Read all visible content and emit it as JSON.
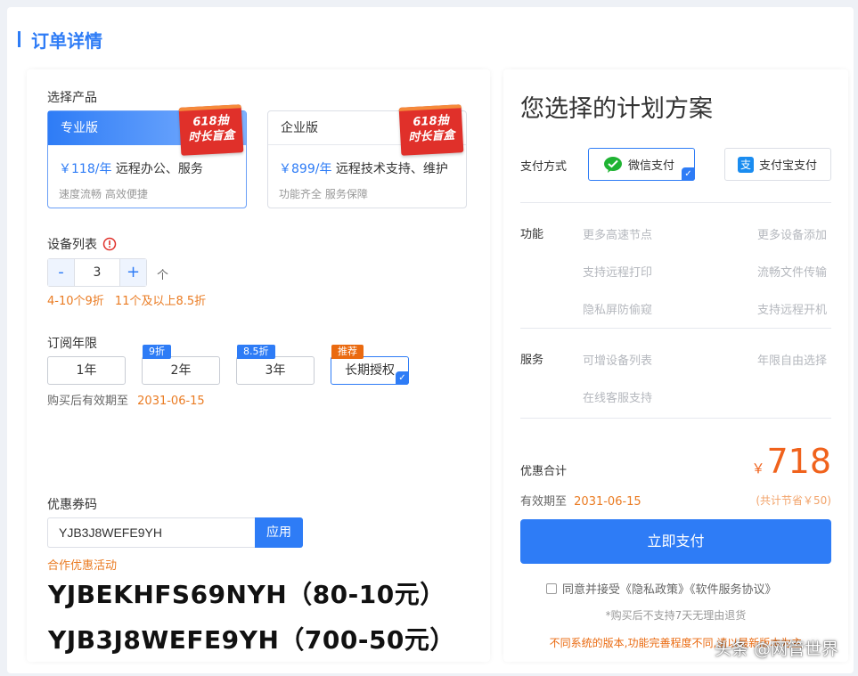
{
  "page_title": "订单详情",
  "product": {
    "label": "选择产品",
    "items": [
      {
        "name": "专业版",
        "price": "￥118/年",
        "price_desc": "远程办公、服务",
        "desc": "速度流畅 高效便捷",
        "badge_line1": "618抽",
        "badge_line2": "时长盲盒"
      },
      {
        "name": "企业版",
        "price": "￥899/年",
        "price_desc": "远程技术支持、维护",
        "desc": "功能齐全 服务保障",
        "badge_line1": "618抽",
        "badge_line2": "时长盲盒"
      }
    ]
  },
  "devices": {
    "label": "设备列表",
    "minus": "-",
    "value": "3",
    "plus": "+",
    "unit": "个",
    "discount1": "4-10个9折",
    "discount2": "11个及以上8.5折"
  },
  "subscription": {
    "label": "订阅年限",
    "options": [
      {
        "label": "1年",
        "tag": ""
      },
      {
        "label": "2年",
        "tag": "9折"
      },
      {
        "label": "3年",
        "tag": "8.5折"
      },
      {
        "label": "长期授权",
        "tag": "推荐"
      }
    ],
    "expiry_prefix": "购买后有效期至",
    "expiry_date": "2031-06-15"
  },
  "coupon": {
    "label": "优惠券码",
    "value": "YJB3J8WEFE9YH",
    "apply": "应用",
    "partner": "合作优惠活动",
    "code1": "YJBEKHFS69NYH（80-10元）",
    "code2": "YJB3J8WEFE9YH（700-50元）"
  },
  "plan": {
    "title": "您选择的计划方案",
    "pay_label": "支付方式",
    "wechat": "微信支付",
    "alipay": "支付宝支付",
    "alipay_icon_char": "支",
    "features_label": "功能",
    "features": [
      "更多高速节点",
      "更多设备添加",
      "支持远程打印",
      "流畅文件传输",
      "隐私屏防偷窥",
      "支持远程开机"
    ],
    "service_label": "服务",
    "services": [
      "可增设备列表",
      "年限自由选择",
      "在线客服支持"
    ],
    "total_label": "优惠合计",
    "currency": "￥",
    "total": "718",
    "expiry_prefix": "有效期至",
    "expiry_date": "2031-06-15",
    "saving": "(共计节省￥50)",
    "submit": "立即支付",
    "agree": "同意并接受《隐私政策》《软件服务协议》",
    "no_refund": "*购买后不支持7天无理由退货",
    "notice": "不同系统的版本,功能完善程度不同,请以最新版本为主"
  },
  "watermark": "头条 @网管世界",
  "colors": {
    "accent": "#2e7cf6",
    "orange": "#ea7b22",
    "price": "#f0621c"
  }
}
